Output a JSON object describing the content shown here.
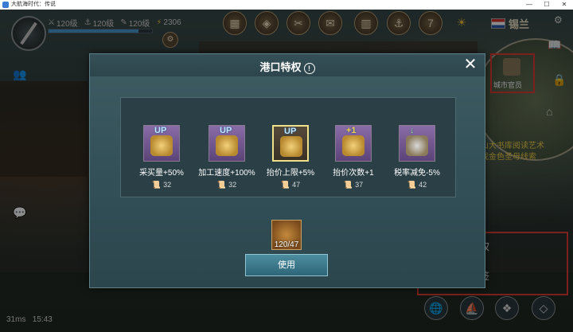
{
  "window": {
    "title": "大航海时代：传说",
    "controls": [
      "—",
      "☐",
      "✕"
    ]
  },
  "hud": {
    "stats": [
      {
        "icon": "swords-icon",
        "glyph": "⚔",
        "value": "120级"
      },
      {
        "icon": "anchor-icon",
        "glyph": "⚓",
        "value": "120级"
      },
      {
        "icon": "quill-icon",
        "glyph": "✎",
        "value": "120级"
      },
      {
        "icon": "energy-icon",
        "glyph": "⚡",
        "value": "2306"
      }
    ],
    "hp_fraction": 0.87,
    "nation": "锡兰",
    "quest_text_line1": "山大书库阅读艺术",
    "quest_text_line2": "找金色圣母线索",
    "city_official_label": "城市官员",
    "right_menu_line1": "权",
    "right_menu_line2": "签",
    "status_ping": "31ms",
    "status_time": "15:43"
  },
  "dialog": {
    "title": "港口特权",
    "close_glyph": "✕",
    "perks": [
      {
        "label": "采买量+50%",
        "cost": "32",
        "badge": "UP"
      },
      {
        "label": "加工速度+100%",
        "cost": "32",
        "badge": "UP"
      },
      {
        "label": "抬价上限+5%",
        "cost": "47",
        "badge": "UP"
      },
      {
        "label": "抬价次数+1",
        "cost": "37",
        "badge": "+1"
      },
      {
        "label": "税率减免-5%",
        "cost": "42",
        "badge": "↓"
      }
    ],
    "inventory_count": "120/47",
    "use_button_label": "使用"
  },
  "colors": {
    "dialog_bg": "#335058",
    "use_button": "#3d7d8f",
    "highlight_red": "#e03b33",
    "quest_text": "#f2d24a"
  }
}
